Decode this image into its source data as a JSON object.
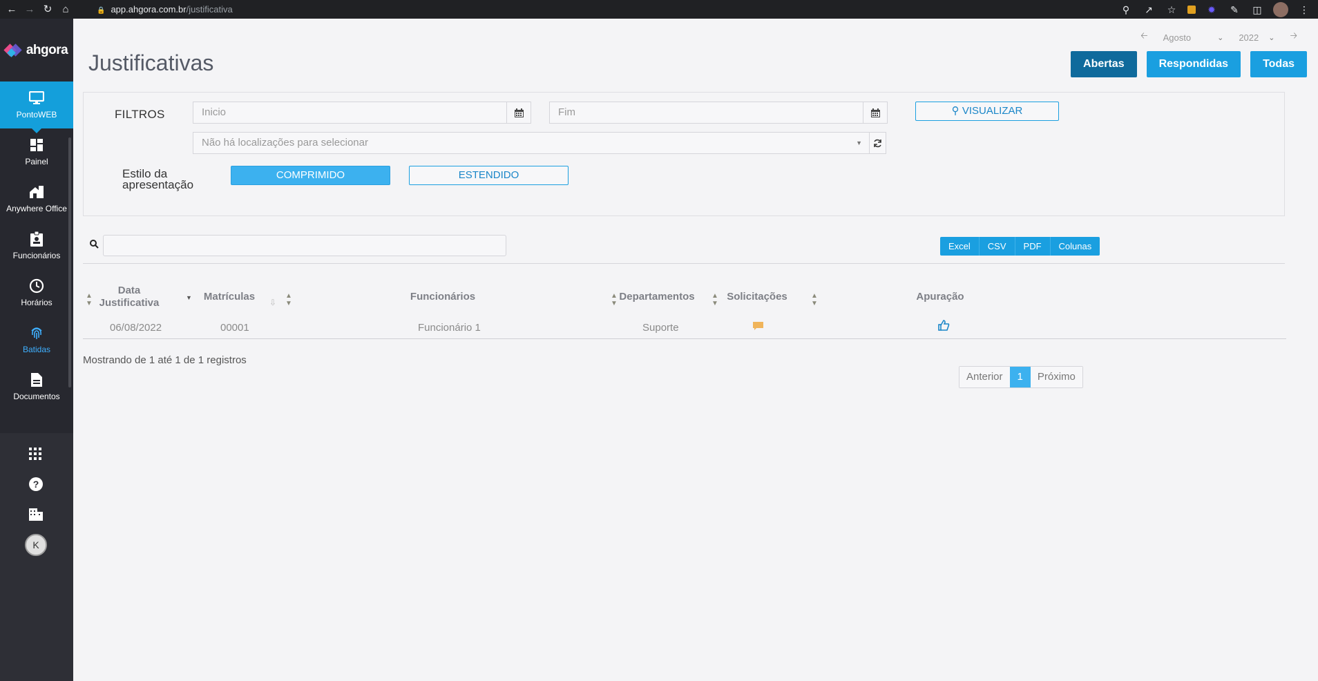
{
  "browser": {
    "url_host": "app.ahgora.com.br",
    "url_path": "/justificativa"
  },
  "sidebar": {
    "logo_text": "ahgora",
    "items": [
      {
        "label": "PontoWEB",
        "icon": "monitor-icon"
      },
      {
        "label": "Painel",
        "icon": "dashboard-icon"
      },
      {
        "label": "Anywhere Office",
        "icon": "home-office-icon"
      },
      {
        "label": "Funcionários",
        "icon": "badge-icon"
      },
      {
        "label": "Horários",
        "icon": "clock-icon"
      },
      {
        "label": "Batidas",
        "icon": "fingerprint-icon"
      },
      {
        "label": "Documentos",
        "icon": "document-icon"
      }
    ],
    "user_initial": "K"
  },
  "period": {
    "month": "Agosto",
    "year": "2022"
  },
  "page": {
    "title": "Justificativas"
  },
  "top_buttons": {
    "abertas": "Abertas",
    "respondidas": "Respondidas",
    "todas": "Todas"
  },
  "filters": {
    "label": "FILTROS",
    "inicio_placeholder": "Inicio",
    "fim_placeholder": "Fim",
    "locations_placeholder": "Não há localizações para selecionar",
    "visualizar": "VISUALIZAR",
    "style_label": "Estilo da apresentação",
    "comprimido": "COMPRIMIDO",
    "estendido": "ESTENDIDO"
  },
  "exports": [
    "Excel",
    "CSV",
    "PDF",
    "Colunas"
  ],
  "table": {
    "headers": {
      "data": "Data Justificativa",
      "matriculas": "Matrículas",
      "funcionarios": "Funcionários",
      "departamentos": "Departamentos",
      "solicitacoes": "Solicitações",
      "apuracao": "Apuração"
    },
    "rows": [
      {
        "data": "06/08/2022",
        "matricula": "00001",
        "funcionario": "Funcionário 1",
        "departamento": "Suporte"
      }
    ]
  },
  "footer": {
    "summary": "Mostrando de 1 até 1 de 1 registros",
    "prev": "Anterior",
    "current": "1",
    "next": "Próximo"
  },
  "colors": {
    "accent": "#1a9fe0",
    "active_dark": "#0f6a9c",
    "sidebar_bg": "#27282f",
    "comment_icon": "#f0b45a"
  }
}
